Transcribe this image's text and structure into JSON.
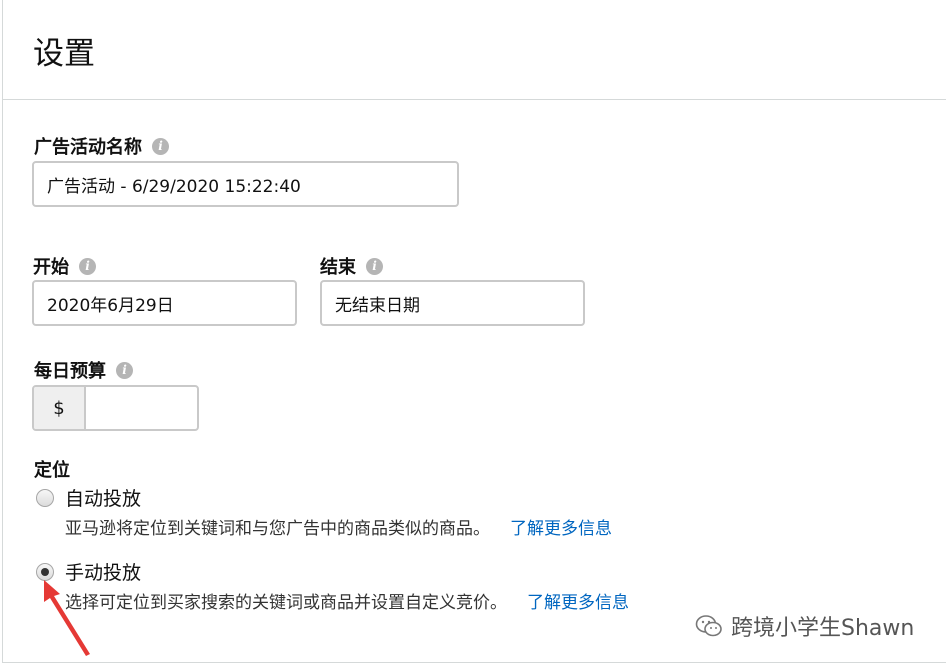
{
  "header": {
    "title": "设置"
  },
  "campaign_name": {
    "label": "广告活动名称",
    "value": "广告活动 - 6/29/2020 15:22:40"
  },
  "start": {
    "label": "开始",
    "value": "2020年6月29日"
  },
  "end": {
    "label": "结束",
    "value": "无结束日期"
  },
  "budget": {
    "label": "每日预算",
    "currency": "$",
    "value": ""
  },
  "targeting": {
    "label": "定位",
    "options": [
      {
        "label": "自动投放",
        "description": "亚马逊将定位到关键词和与您广告中的商品类似的商品。",
        "link": "了解更多信息",
        "selected": false
      },
      {
        "label": "手动投放",
        "description": "选择可定位到买家搜索的关键词或商品并设置自定义竞价。",
        "link": "了解更多信息",
        "selected": true
      }
    ]
  },
  "watermark": {
    "text": "跨境小学生Shawn",
    "icon": "wechat-icon"
  },
  "colors": {
    "link": "#0066c0",
    "arrow": "#e53935",
    "border": "#c9c9c9"
  }
}
